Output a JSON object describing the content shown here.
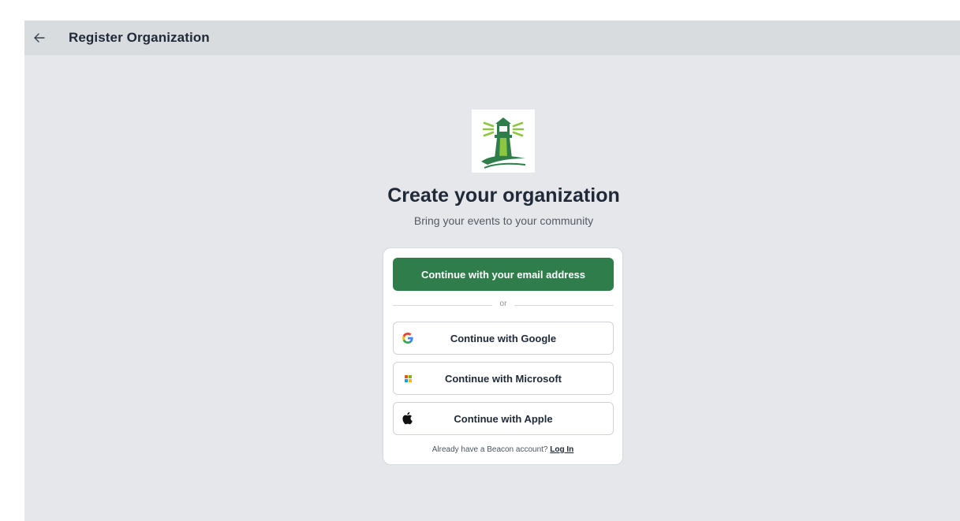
{
  "header": {
    "title": "Register Organization",
    "back_icon": "arrow-left-icon"
  },
  "main": {
    "logo_icon": "lighthouse-logo",
    "heading": "Create your organization",
    "subheading": "Bring your events to your community"
  },
  "auth_card": {
    "email_button": "Continue with your email address",
    "divider_text": "or",
    "google_button": "Continue with Google",
    "microsoft_button": "Continue with Microsoft",
    "apple_button": "Continue with Apple",
    "footer_prompt": "Already have a Beacon account?",
    "login_link": "Log In"
  },
  "colors": {
    "primary": "#2f7d4a",
    "header_bg": "#d9dcdf",
    "page_bg": "#e5e7eb"
  }
}
